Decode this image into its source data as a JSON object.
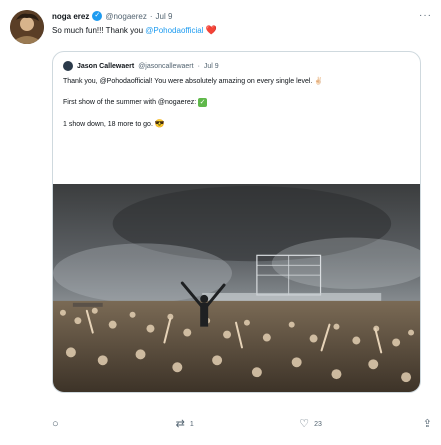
{
  "tweet": {
    "author_name": "noga erez",
    "handle": "@nogaerez",
    "separator": "·",
    "date": "Jul 9",
    "text_prefix": "So much fun!!! Thank you ",
    "text_mention": "@Pohodaofficial",
    "heart_emoji": "❤️"
  },
  "quote": {
    "author_name": "Jason Callewaert",
    "handle": "@jasoncallewaert",
    "separator": "·",
    "date": "Jul 9",
    "line1": "Thank you, @Pohodaofficial! You were absolutely amazing on every single level. ✌🏻",
    "line2_text": "First show of the summer with @nogaerez: ",
    "line2_check": "✓",
    "line3_text": "1 show down, 18 more to go. ",
    "line3_emoji": "😎"
  },
  "actions": {
    "reply_count": "",
    "retweet_count": "1",
    "like_count": "23",
    "share_label": ""
  },
  "icons": {
    "verified": "verified-badge-icon",
    "reply": "reply-icon",
    "retweet": "retweet-icon",
    "like": "heart-icon",
    "share": "share-icon",
    "more": "more-icon"
  },
  "colors": {
    "accent": "#1d9bf0",
    "text": "#0f1419",
    "muted": "#536471",
    "border": "#cfd9de"
  }
}
